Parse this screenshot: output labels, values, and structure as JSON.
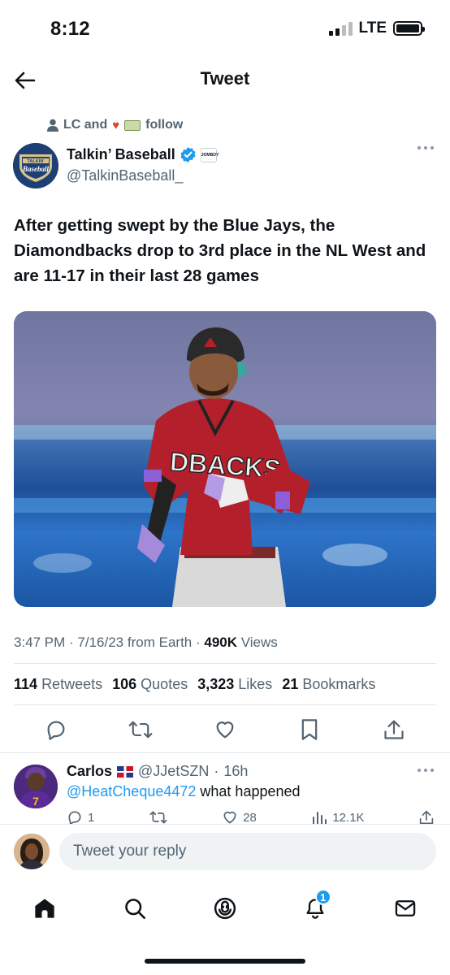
{
  "status_bar": {
    "time": "8:12",
    "network": "LTE"
  },
  "header": {
    "title": "Tweet"
  },
  "social_context": {
    "text": "LC and",
    "suffix": "follow"
  },
  "author": {
    "name": "Talkin’ Baseball",
    "handle": "@TalkinBaseball_",
    "logo_text": "TALKIN' Baseball"
  },
  "tweet": {
    "text": "After getting swept by the Blue Jays, the Diamondbacks drop to 3rd place in the NL West and are 11-17 in their last 28 games",
    "media_jersey_text": "DBACKS",
    "time": "3:47 PM",
    "date": "7/16/23",
    "source": "from Earth",
    "views_count": "490K",
    "views_label": "Views"
  },
  "stats": {
    "retweets_count": "114",
    "retweets_label": "Retweets",
    "quotes_count": "106",
    "quotes_label": "Quotes",
    "likes_count": "3,323",
    "likes_label": "Likes",
    "bookmarks_count": "21",
    "bookmarks_label": "Bookmarks"
  },
  "reply": {
    "name": "Carlos",
    "handle": "@JJetSZN",
    "time": "16h",
    "mention": "@HeatCheque4472",
    "text": "what happened",
    "replies": "1",
    "likes": "28",
    "views": "12.1K"
  },
  "composer": {
    "placeholder": "Tweet your reply"
  },
  "tabbar": {
    "notifications_badge": "1"
  },
  "colors": {
    "accent": "#1d9bf0",
    "text": "#0f1419",
    "muted": "#536471",
    "dbacks_red": "#a71930"
  }
}
